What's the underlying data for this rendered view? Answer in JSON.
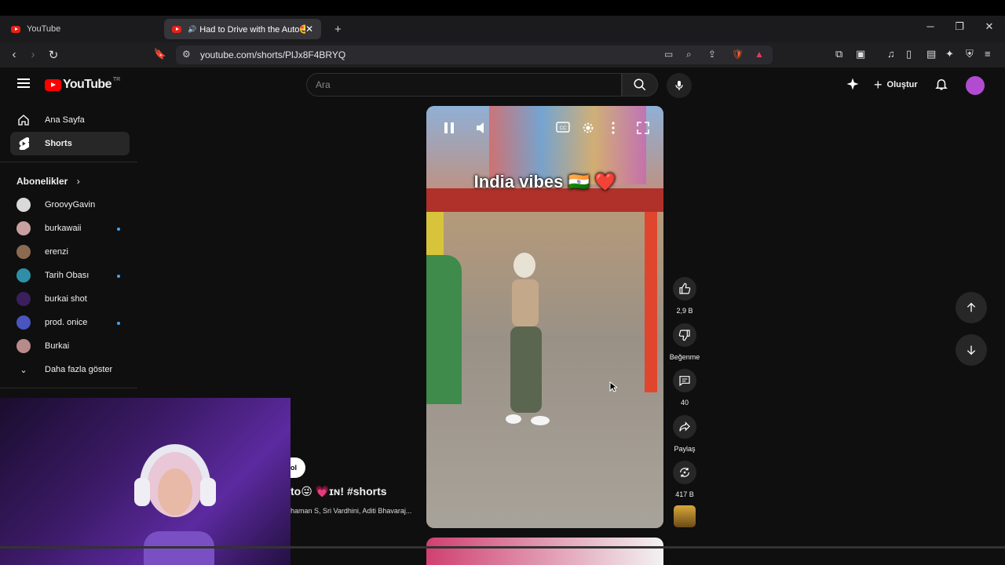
{
  "browser": {
    "tabs": [
      {
        "label": "YouTube",
        "active": false
      },
      {
        "label": "Had to Drive with the Auto🤩",
        "active": true
      }
    ],
    "new_tab": "+",
    "url": "youtube.com/shorts/PlJx8F4BRYQ"
  },
  "youtube": {
    "logo_text": "YouTube",
    "country_code": "TR",
    "search_placeholder": "Ara",
    "create_label": "Oluştur"
  },
  "sidebar": {
    "items": [
      {
        "label": "Ana Sayfa",
        "icon": "home-icon",
        "active": false
      },
      {
        "label": "Shorts",
        "icon": "shorts-icon",
        "active": true
      }
    ],
    "subscriptions_heading": "Abonelikler",
    "subscriptions": [
      {
        "name": "GroovyGavin",
        "new": false,
        "color": "#d9d9d9"
      },
      {
        "name": "burkawaii",
        "new": true,
        "color": "#c9a0a0"
      },
      {
        "name": "erenzi",
        "new": false,
        "color": "#8a6a50"
      },
      {
        "name": "Tarih Obası",
        "new": true,
        "color": "#2f8fa8"
      },
      {
        "name": "burkai shot",
        "new": false,
        "color": "#3a1f5c"
      },
      {
        "name": "prod. onice",
        "new": true,
        "color": "#4a55c0"
      },
      {
        "name": "Burkai",
        "new": false,
        "color": "#b98a8a"
      }
    ],
    "show_more": "Daha fazla göster"
  },
  "short": {
    "caption": "India vibes 🇮🇳 ❤️",
    "title": "to😜 💗ɪɴ! #shorts",
    "credits": "haman S, Sri Vardhini, Aditi Bhavaraj...",
    "subscribe_pill": "ol"
  },
  "actions": {
    "likes": "2,9 B",
    "dislike_label": "Beğenme",
    "comments": "40",
    "share_label": "Paylaş",
    "remix_count": "417 B"
  }
}
